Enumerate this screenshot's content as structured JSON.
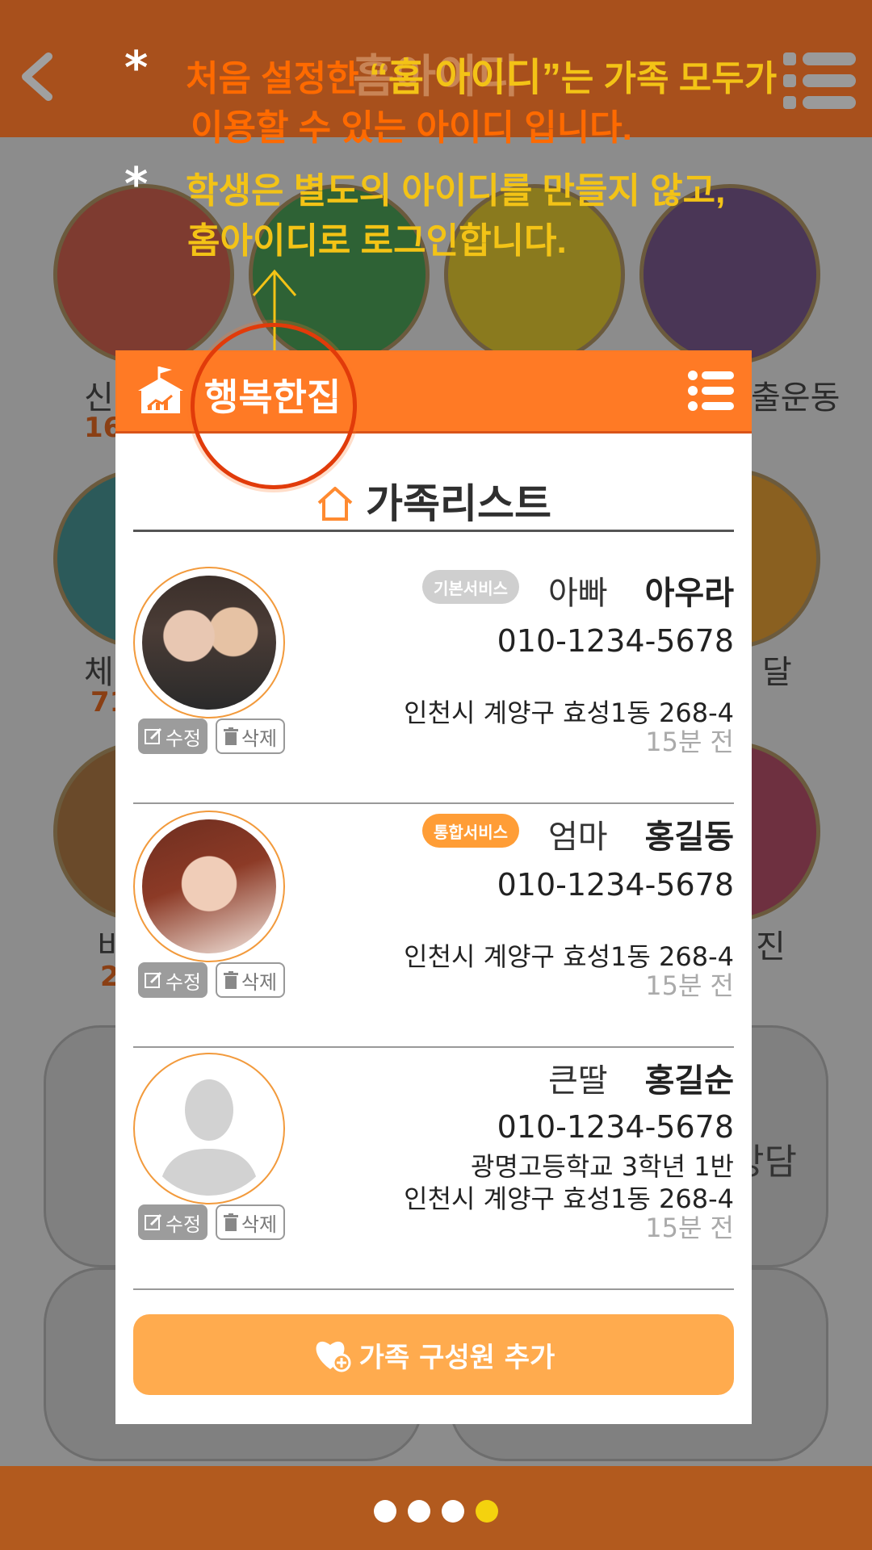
{
  "background": {
    "title": "홈아이디",
    "items": [
      {
        "label": "신"
      },
      {
        "label": "출운동"
      },
      {
        "label": "체"
      },
      {
        "label": "달"
      },
      {
        "label": "비"
      },
      {
        "label": "진"
      }
    ],
    "nums": [
      "16",
      "71",
      "2"
    ],
    "card_texts": [
      "상담"
    ]
  },
  "tips": {
    "tip1_prefix": "처음 설정한",
    "tip1_quote": "“홈 아이디”",
    "tip1_suffix": "는  가족 모두가",
    "tip1_line2": "이용할 수 있는 아이디 입니다.",
    "tip2_line1": "학생은 별도의 아이디를 만들지 않고,",
    "tip2_line2": "홈아이디로 로그인합니다.",
    "star": "*"
  },
  "modal": {
    "home_name": "행복한집",
    "list_title": "가족리스트",
    "edit_label": "수정",
    "delete_label": "삭제",
    "members": [
      {
        "badge": "기본서비스",
        "relation": "아빠",
        "name": "아우라",
        "phone": "010-1234-5678",
        "school": "",
        "address": "인천시 계양구 효성1동 268-4",
        "time": "15분 전"
      },
      {
        "badge": "통합서비스",
        "relation": "엄마",
        "name": "홍길동",
        "phone": "010-1234-5678",
        "school": "",
        "address": "인천시 계양구 효성1동 268-4",
        "time": "15분 전"
      },
      {
        "badge": "",
        "relation": "큰딸",
        "name": "홍길순",
        "phone": "010-1234-5678",
        "school": "광명고등학교 3학년 1반",
        "address": "인천시 계양구 효성1동 268-4",
        "time": "15분 전"
      }
    ],
    "add_label": "가족 구성원 추가"
  },
  "pager": {
    "total": 4,
    "active": 4
  },
  "colors": {
    "accent": "#ff7a25",
    "accent_light": "#ffab4e",
    "tip_orange": "#ff6a00",
    "tip_yellow": "#f3c316",
    "header_bg": "#a8501c"
  }
}
